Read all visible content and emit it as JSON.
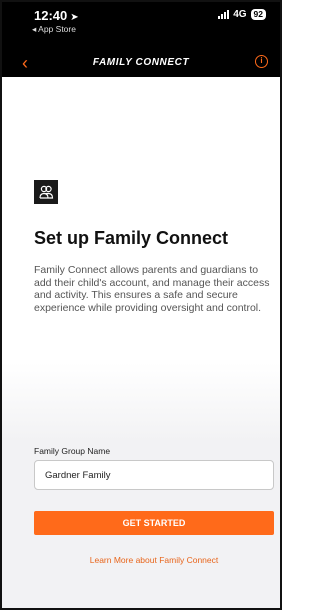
{
  "status_bar": {
    "time": "12:40",
    "back_app": "◂ App Store",
    "network": "4G",
    "battery": "92"
  },
  "nav": {
    "title": "FAMILY CONNECT"
  },
  "content": {
    "headline": "Set up Family Connect",
    "description": "Family Connect allows parents and guardians to add their child's account, and manage their access and activity. This ensures a safe and secure experience while providing oversight and control."
  },
  "form": {
    "group_name_label": "Family Group Name",
    "group_name_value": "Gardner Family",
    "submit_label": "GET STARTED",
    "learn_more": "Learn More about Family Connect"
  },
  "colors": {
    "accent": "#ff6a1a",
    "header_bg": "#000000",
    "panel_bg": "#f2f2f4"
  },
  "icons": [
    "location-arrow-icon",
    "signal-icon",
    "battery-icon",
    "back-chevron-icon",
    "info-icon",
    "people-icon"
  ]
}
